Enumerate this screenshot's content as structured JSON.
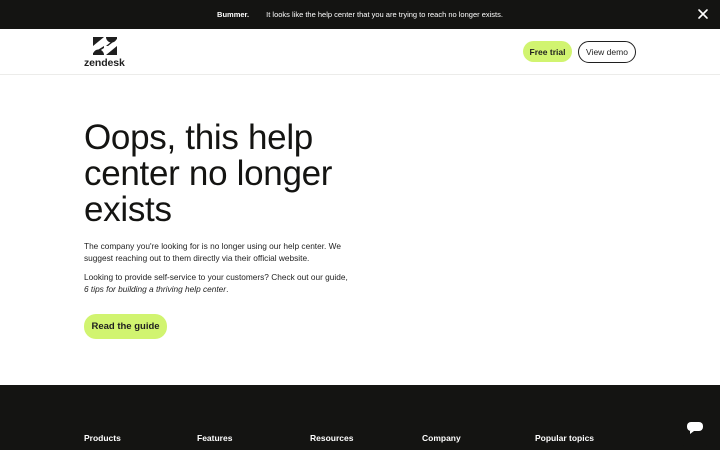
{
  "banner": {
    "strong": "Bummer.",
    "message": "It looks like the help center that you are trying to reach no longer exists."
  },
  "header": {
    "logo_text": "zendesk",
    "free_trial_label": "Free trial",
    "view_demo_label": "View demo"
  },
  "main": {
    "title": "Oops, this help center no longer exists",
    "paragraph1": "The company you're looking for is no longer using our help center. We suggest reaching out to them directly via their official website.",
    "paragraph2_prefix": "Looking to provide self-service to your customers? Check out our guide, ",
    "paragraph2_link": "6 tips for building a thriving help center",
    "paragraph2_suffix": ".",
    "guide_button_label": "Read the guide"
  },
  "footer": {
    "columns": [
      "Products",
      "Features",
      "Resources",
      "Company",
      "Popular topics"
    ]
  },
  "colors": {
    "accent": "#d1f470",
    "dark": "#141412"
  },
  "icons": {
    "close": "close-icon",
    "logo": "zendesk-logo-icon",
    "chat": "chat-icon"
  }
}
